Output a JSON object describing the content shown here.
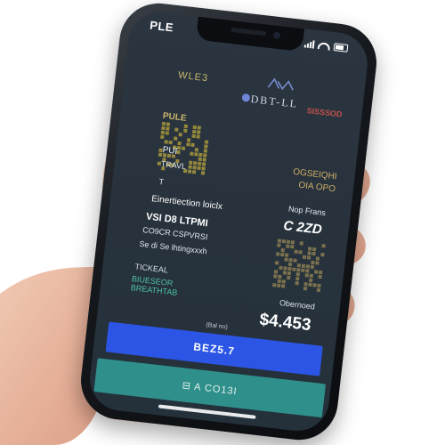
{
  "status_bar": {
    "carrier": "PLE"
  },
  "header": {
    "left_label": "WLE3",
    "brand_name": "DBT-LL",
    "badge": "SISSSOD"
  },
  "ticket": {
    "ref": "PULE",
    "passenger": "PUI",
    "travel_label": "TRAVL",
    "mark": "T",
    "destination": "Einertiection loiclx",
    "flight": "VSI D8 LTPMI",
    "coach": "CO9CR CSPVRSI",
    "seat": "Se di Se lhtingxxxh",
    "ticket_label": "TICKEAL",
    "benefit_1": "BIUESEOR",
    "benefit_2": "BREATHTAB",
    "origin_1": "OGSEIQHI",
    "origin_2": "OIA OPO",
    "price_label": "Nop Frans",
    "price_small": "C 2ZD",
    "obtained_label": "Obernoed",
    "price_total": "$4.453",
    "small_caption": "(Bal no)"
  },
  "actions": {
    "primary_label": "BEZ5.7",
    "secondary_label": "⊟ A CO13I"
  },
  "colors": {
    "screen_bg": "#27323c",
    "primary_button": "#2c55e6",
    "secondary_button": "#2f8f8a",
    "accent_gold": "#c9b46a",
    "accent_teal": "#4fc4a4",
    "badge_red": "#c0504a"
  },
  "icons": [
    "signal-icon",
    "wifi-icon",
    "battery-icon",
    "brand-logo-icon",
    "qr-code-icon"
  ]
}
